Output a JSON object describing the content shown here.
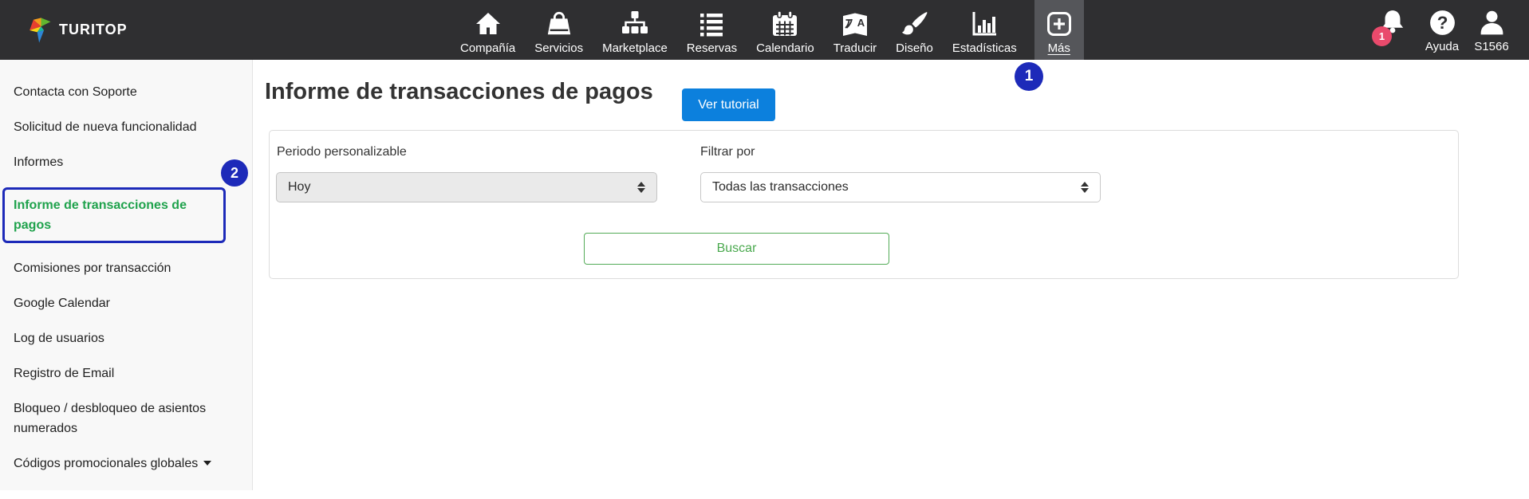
{
  "brand": {
    "name": "TURITOP"
  },
  "topnav": {
    "items": [
      {
        "label": "Compañía",
        "icon": "home"
      },
      {
        "label": "Servicios",
        "icon": "shopping-bag"
      },
      {
        "label": "Marketplace",
        "icon": "sitemap"
      },
      {
        "label": "Reservas",
        "icon": "list"
      },
      {
        "label": "Calendario",
        "icon": "calendar"
      },
      {
        "label": "Traducir",
        "icon": "translate"
      },
      {
        "label": "Diseño",
        "icon": "paintbrush"
      },
      {
        "label": "Estadísticas",
        "icon": "bar-chart"
      },
      {
        "label": "Más",
        "icon": "plus-square",
        "active": true
      }
    ]
  },
  "topbar_right": {
    "notification_count": "1",
    "help_label": "Ayuda",
    "user_label": "S1566"
  },
  "annotations": {
    "step_1": "1",
    "step_2": "2"
  },
  "sidebar": {
    "items": [
      {
        "label": "Contacta con Soporte"
      },
      {
        "label": "Solicitud de nueva funcionalidad"
      },
      {
        "label": "Informes"
      },
      {
        "label": "Informe de transacciones de pagos",
        "active": true
      },
      {
        "label": "Comisiones por transacción"
      },
      {
        "label": "Google Calendar"
      },
      {
        "label": "Log de usuarios"
      },
      {
        "label": "Registro de Email"
      },
      {
        "label": "Bloqueo / desbloqueo de asientos numerados"
      },
      {
        "label": "Códigos promocionales globales",
        "has_caret": true
      }
    ]
  },
  "main": {
    "title": "Informe de transacciones de pagos",
    "tutorial_button_label": "Ver tutorial",
    "filter_panel": {
      "period_label": "Periodo personalizable",
      "period_value": "Hoy",
      "filter_label": "Filtrar por",
      "filter_value": "Todas las transacciones",
      "search_button_label": "Buscar"
    }
  },
  "colors": {
    "topbar_bg": "#2f2f31",
    "active_nav_bg": "#55565a",
    "annotation_blue": "#1d2ab9",
    "sidebar_active_green": "#1fa24c",
    "tutorial_button_blue": "#0c80dd",
    "search_button_green": "#53ab57",
    "notification_badge_pink": "#e94a6c"
  }
}
